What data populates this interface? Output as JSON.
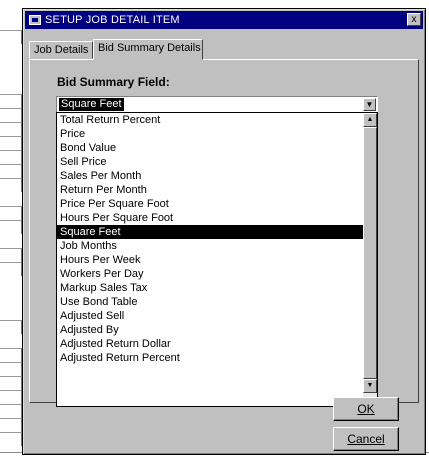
{
  "dialog": {
    "title": "SETUP JOB DETAIL ITEM",
    "close_label": "x",
    "tabs": [
      {
        "label": "Job Details"
      },
      {
        "label": "Bid Summary Details"
      }
    ],
    "field_label": "Bid Summary Field:",
    "combo": {
      "selected_value": "Square Feet"
    },
    "dropdown": {
      "items": [
        "Total Return Percent",
        "Price",
        "Bond Value",
        "Sell Price",
        "Sales Per Month",
        "Return Per Month",
        "Price Per Square Foot",
        "Hours Per Square Foot",
        "Square Feet",
        "Job Months",
        "Hours Per Week",
        "Workers Per Day",
        "Markup Sales Tax",
        "Use Bond Table",
        "Adjusted Sell",
        "Adjusted By",
        "Adjusted Return Dollar",
        "Adjusted Return Percent"
      ],
      "selected_item": "Square Feet"
    },
    "buttons": {
      "ok": "OK",
      "cancel": "Cancel"
    }
  },
  "icons": {
    "scroll_up": "up-arrow-icon",
    "scroll_down": "down-arrow-icon",
    "combo_arrow": "chevron-down-icon",
    "app": "window-icon"
  },
  "colors": {
    "title_bar": "#000080",
    "dialog_face": "#c0c0c0",
    "selection": "#000000"
  }
}
